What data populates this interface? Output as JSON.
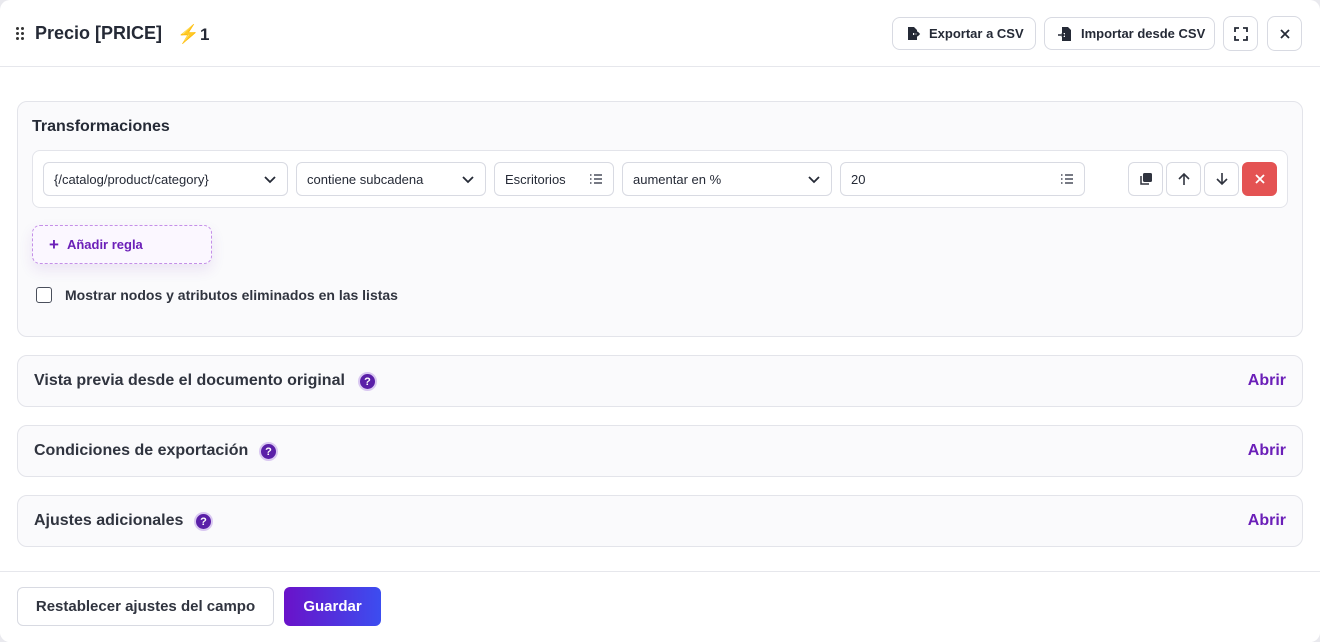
{
  "header": {
    "title": "Precio [PRICE]",
    "badge_count": "1",
    "export_label": "Exportar a CSV",
    "import_label": "Importar desde CSV"
  },
  "transformations": {
    "title": "Transformaciones",
    "rule": {
      "field": "{/catalog/product/category}",
      "condition": "contiene subcadena",
      "value": "Escritorios",
      "action": "aumentar en %",
      "amount": "20"
    },
    "add_rule_label": "Añadir regla",
    "checkbox_label": "Mostrar nodos y atributos eliminados en las listas",
    "checkbox_checked": false
  },
  "sections": [
    {
      "title": "Vista previa desde el documento original",
      "open_label": "Abrir"
    },
    {
      "title": "Condiciones de exportación",
      "open_label": "Abrir"
    },
    {
      "title": "Ajustes adicionales",
      "open_label": "Abrir"
    }
  ],
  "footer": {
    "reset_label": "Restablecer ajustes del campo",
    "save_label": "Guardar"
  },
  "colors": {
    "accent": "#6b1fb8",
    "danger": "#e45353",
    "bolt": "#f0b414"
  },
  "icons": {
    "drag": "drag-handle-icon",
    "bolt": "bolt-icon",
    "export": "file-export-icon",
    "import": "file-import-icon",
    "fullscreen": "expand-icon",
    "close": "close-icon",
    "dropdown": "chevron-down-icon",
    "list": "list-icon",
    "duplicate": "copy-icon",
    "up": "arrow-up-icon",
    "down": "arrow-down-icon",
    "delete": "close-icon",
    "add": "plus-icon",
    "help": "help-icon"
  }
}
